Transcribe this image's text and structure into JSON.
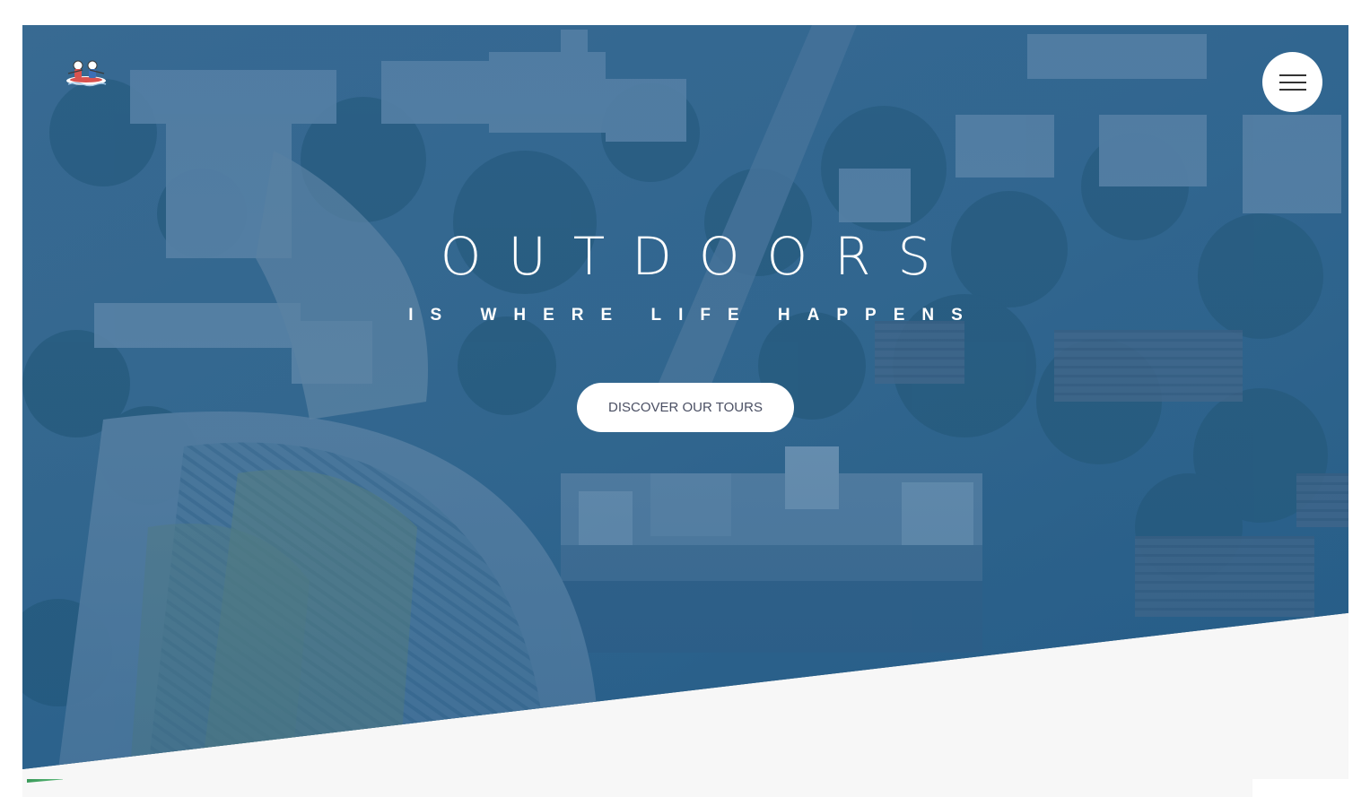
{
  "hero": {
    "headline": "OUTDOORS",
    "subline": "IS WHERE LIFE HAPPENS",
    "cta_label": "DISCOVER OUR TOURS",
    "overlay_color": "#1f5c91",
    "background": "aerial-city-photo"
  },
  "header": {
    "logo": "rafting-logo",
    "menu_icon": "hamburger-menu-icon"
  },
  "colors": {
    "accent_green": "#3a9a5a",
    "cta_text": "#4a4f63",
    "section_bg": "#f7f7f7"
  }
}
